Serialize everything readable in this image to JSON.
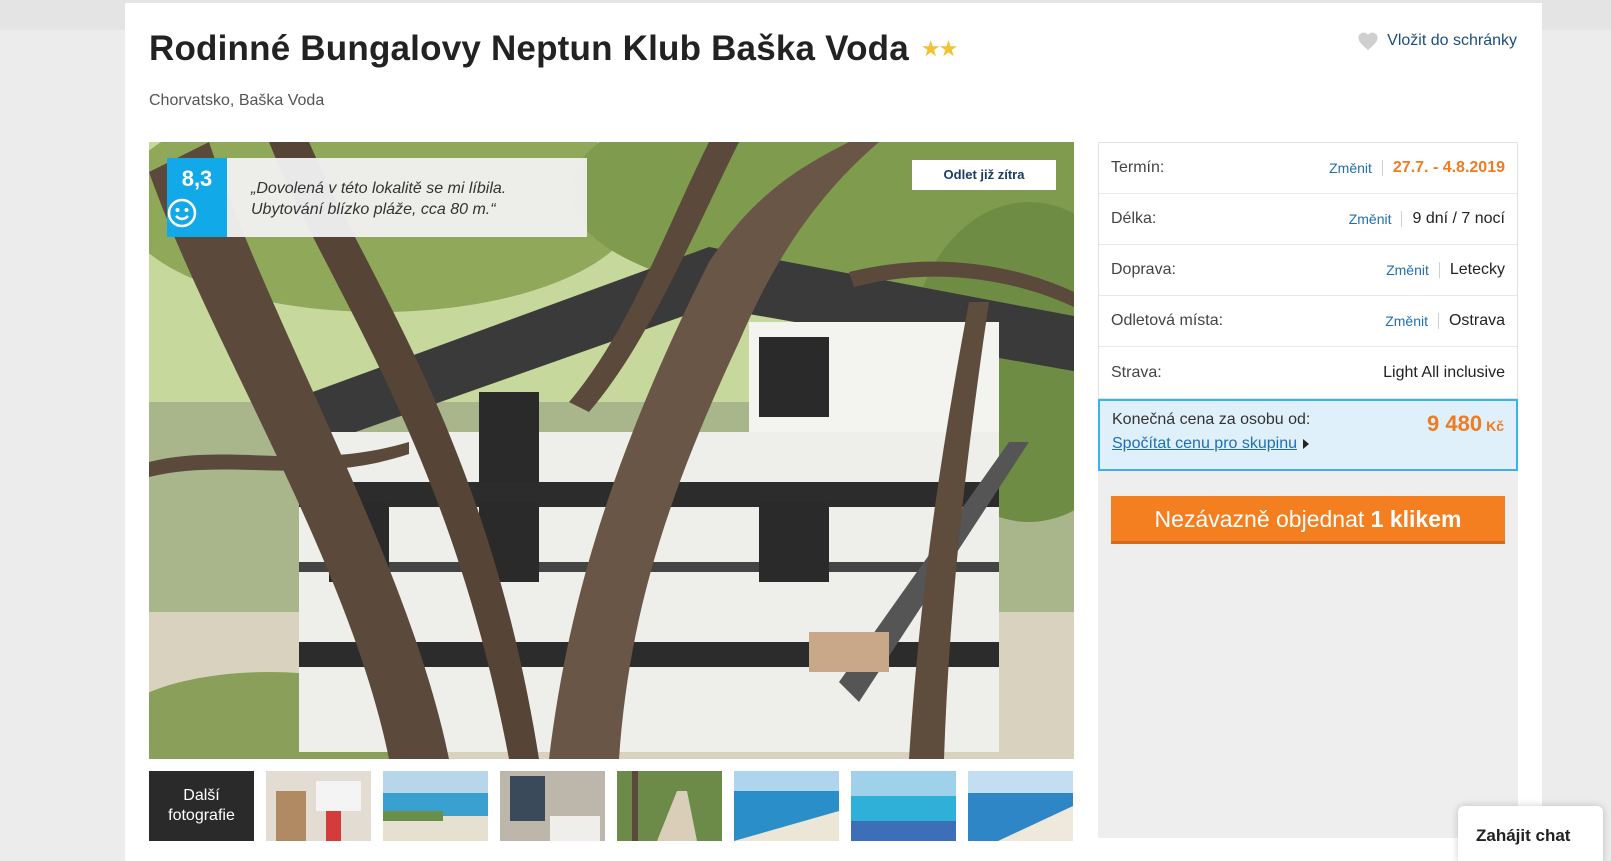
{
  "hotel": {
    "title": "Rodinné Bungalovy Neptun Klub Baška Voda",
    "stars_glyph": "★★",
    "location": "Chorvatsko, Baška Voda",
    "favorite_label": "Vložit do schránky"
  },
  "review": {
    "score": "8,3",
    "quote": "„Dovolená v této lokalitě se mi líbila. Ubytování blízko pláže, cca 80 m.“",
    "icon": "smiley-icon"
  },
  "badge": {
    "label": "Odlet již zítra"
  },
  "gallery": {
    "more_label": "Další fotografie",
    "thumb_count": 7
  },
  "booking": {
    "change_label": "Změnit",
    "rows": [
      {
        "label": "Termín:",
        "value": "27.7. - 4.8.2019"
      },
      {
        "label": "Délka:",
        "value": "9 dní / 7 nocí"
      },
      {
        "label": "Doprava:",
        "value": "Letecky"
      },
      {
        "label": "Odletová místa:",
        "value": "Ostrava"
      },
      {
        "label": "Strava:",
        "value": "Light All inclusive"
      }
    ],
    "price_label": "Konečná cena za osobu od:",
    "price_value": "9 480",
    "price_currency": "Kč",
    "group_link": "Spočítat cenu pro skupinu",
    "order_button": {
      "prefix": "Nezávazně objednat",
      "bold": "1 klikem"
    }
  },
  "chat": {
    "label": "Zahájit chat"
  },
  "colors": {
    "accent_orange": "#f47f20",
    "link_blue": "#1e6fb3",
    "score_blue": "#11a9e8",
    "star_yellow": "#f2c233"
  }
}
